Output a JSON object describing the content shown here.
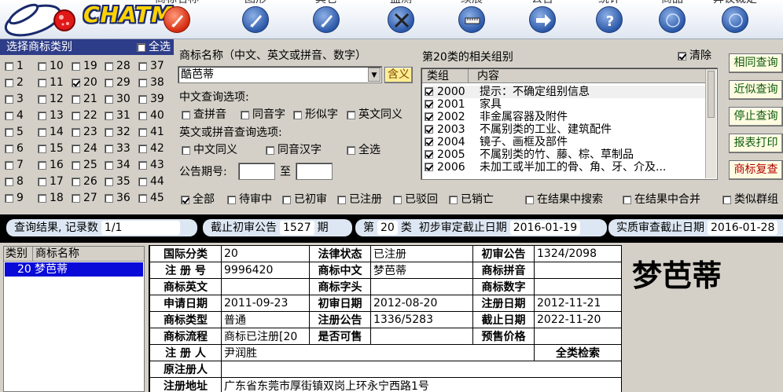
{
  "app": {
    "logo_text": "CHATM"
  },
  "toolbar": [
    {
      "label": "商标名称",
      "icon": "pen-icon",
      "active": true
    },
    {
      "label": "图形",
      "icon": "pen-icon"
    },
    {
      "label": "其它",
      "icon": "pen-icon"
    },
    {
      "label": "监测",
      "icon": "tools-icon"
    },
    {
      "label": "续展",
      "icon": "ruler-icon"
    },
    {
      "label": "公告",
      "icon": "arrow-icon"
    },
    {
      "label": "统计",
      "icon": "help-icon"
    },
    {
      "label": "商品",
      "icon": "globe-icon"
    },
    {
      "label": "异议裁定",
      "icon": "globe-icon"
    }
  ],
  "category_panel": {
    "title": "选择商标类别",
    "select_all": "全选",
    "columns": [
      [
        "1",
        "2",
        "3",
        "4",
        "5",
        "6",
        "7",
        "8",
        "9"
      ],
      [
        "10",
        "11",
        "12",
        "13",
        "14",
        "15",
        "16",
        "17",
        "18"
      ],
      [
        "19",
        "20",
        "21",
        "22",
        "23",
        "24",
        "25",
        "26",
        "27"
      ],
      [
        "28",
        "29",
        "30",
        "31",
        "32",
        "33",
        "34",
        "35",
        "36"
      ],
      [
        "37",
        "38",
        "39",
        "40",
        "41",
        "42",
        "43",
        "44",
        "45"
      ]
    ],
    "checked": [
      "20"
    ]
  },
  "query": {
    "name_label": "商标名称（中文、英文或拼音、数字）",
    "name_value": "酷芭蒂",
    "contains_button": "含义",
    "chinese_options_label": "中文查询选项:",
    "chinese_options": [
      "查拼音",
      "同音字",
      "形似字",
      "英文同义"
    ],
    "en_options_label": "英文或拼音查询选项:",
    "en_options": [
      "中文同义",
      "同音汉字",
      "全选"
    ],
    "period_label": "公告期号:",
    "period_to": "至",
    "period_from_value": "",
    "period_to_value": ""
  },
  "groups": {
    "title": "第20类的相关组别",
    "clear_label": "清除",
    "col_group": "类组",
    "col_content": "内容",
    "rows": [
      {
        "code": "2000",
        "desc": "提示：不确定组别信息"
      },
      {
        "code": "2001",
        "desc": "家具"
      },
      {
        "code": "2002",
        "desc": "非金属容器及附件"
      },
      {
        "code": "2003",
        "desc": "不属别类的工业、建筑配件"
      },
      {
        "code": "2004",
        "desc": "镜子、画框及部件"
      },
      {
        "code": "2005",
        "desc": "不属别类的竹、藤、棕、草制品"
      },
      {
        "code": "2006",
        "desc": "未加工或半加工的骨、角、牙、介及..."
      }
    ]
  },
  "side_buttons": [
    "相同查询",
    "近似查询",
    "停止查询",
    "报表打印",
    "商标复查"
  ],
  "status_filters": [
    "全部",
    "待审中",
    "已初审",
    "已注册",
    "已驳回",
    "已销亡"
  ],
  "search_options": [
    "在结果中搜索",
    "在结果中合并",
    "类似群组"
  ],
  "result_bar": {
    "records_label": "查询结果, 记录数",
    "records_value": "1/1",
    "cutoff_label": "截止初审公告",
    "cutoff_value": "1527",
    "cutoff_unit": "期",
    "class_prefix": "第",
    "class_value": "20",
    "class_suffix": "类",
    "initial_label": "初步审定截止日期",
    "initial_value": "2016-01-19",
    "exam_label": "实质审查截止日期",
    "exam_value": "2016-01-28"
  },
  "result_list": {
    "col_class": "类别",
    "col_name": "商标名称",
    "rows": [
      {
        "class": "20",
        "name": "梦芭蒂"
      }
    ]
  },
  "detail": {
    "intl_class_k": "国际分类",
    "intl_class_v": "20",
    "legal_status_k": "法律状态",
    "legal_status_v": "已注册",
    "prelim_notice_k": "初审公告",
    "prelim_notice_v": "1324/2098",
    "reg_no_k": "注 册 号",
    "reg_no_v": "9996420",
    "name_cn_k": "商标中文",
    "name_cn_v": "梦芭蒂",
    "pinyin_k": "商标拼音",
    "pinyin_v": "",
    "name_en_k": "商标英文",
    "name_en_v": "",
    "initial_k": "商标字头",
    "initial_v": "",
    "digits_k": "商标数字",
    "digits_v": "",
    "apply_date_k": "申请日期",
    "apply_date_v": "2011-09-23",
    "prelim_date_k": "初审日期",
    "prelim_date_v": "2012-08-20",
    "reg_date_k": "注册日期",
    "reg_date_v": "2012-11-21",
    "type_k": "商标类型",
    "type_v": "普通",
    "reg_notice_k": "注册公告",
    "reg_notice_v": "1336/5283",
    "expire_k": "截止日期",
    "expire_v": "2022-11-20",
    "flow_k": "商标流程",
    "flow_v": "商标已注册[20",
    "for_sale_k": "是否可售",
    "for_sale_v": "",
    "price_k": "预售价格",
    "price_v": "",
    "registrant_k": "注 册 人",
    "registrant_v": "尹润胜",
    "full_search": "全类检索",
    "orig_registrant_k": "原注册人",
    "orig_registrant_v": "",
    "address_k": "注册地址",
    "address_v": "广东省东莞市厚街镇双岗上环永宁西路1号"
  },
  "preview_name": "梦芭蒂"
}
